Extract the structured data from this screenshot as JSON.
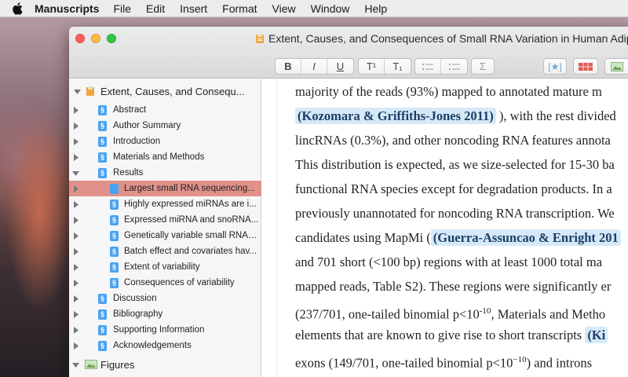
{
  "menubar": {
    "app_name": "Manuscripts",
    "items": [
      "File",
      "Edit",
      "Insert",
      "Format",
      "View",
      "Window",
      "Help"
    ]
  },
  "window": {
    "title": "Extent, Causes, and Consequences of Small RNA Variation in Human Adipos"
  },
  "toolbar": {
    "bold": "B",
    "italic": "I",
    "underline": "U",
    "superscript": "T¹",
    "subscript": "T₁",
    "equation": "Σ",
    "citation": "[★]"
  },
  "sidebar": {
    "root_label": "Extent, Causes, and Consequ...",
    "sections": [
      {
        "label": "Abstract"
      },
      {
        "label": "Author Summary"
      },
      {
        "label": "Introduction"
      },
      {
        "label": "Materials and Methods"
      },
      {
        "label": "Results"
      }
    ],
    "results_children": [
      {
        "label": "Largest small RNA sequencing..."
      },
      {
        "label": "Highly expressed miRNAs are i..."
      },
      {
        "label": "Expressed miRNA and snoRNA..."
      },
      {
        "label": "Genetically variable small RNAs..."
      },
      {
        "label": "Batch effect and covariates hav..."
      },
      {
        "label": "Extent of variability"
      },
      {
        "label": "Consequences of variability"
      }
    ],
    "more_sections": [
      {
        "label": "Discussion"
      },
      {
        "label": "Bibliography"
      },
      {
        "label": "Supporting Information"
      },
      {
        "label": "Acknowledgements"
      }
    ],
    "figures_label": "Figures"
  },
  "content": {
    "lines": [
      {
        "pre": "majority of the reads (93%) mapped to annotated mature m",
        "cite": "",
        "post": ""
      },
      {
        "pre": "",
        "cite": "(Kozomara & Griffiths-Jones 2011)",
        "post": " ), with the rest divided"
      },
      {
        "pre": "lincRNAs (0.3%), and other noncoding RNA features annota",
        "cite": "",
        "post": ""
      },
      {
        "pre": "This distribution is expected, as we size-selected for 15-30 ba",
        "cite": "",
        "post": ""
      },
      {
        "pre": "functional RNA species except for degradation products. In a",
        "cite": "",
        "post": ""
      },
      {
        "pre": "previously unannotated for noncoding RNA transcription. We",
        "cite": "",
        "post": ""
      },
      {
        "pre": "candidates using MapMi (",
        "cite": "(Guerra-Assuncao & Enright 201",
        "post": ""
      },
      {
        "pre": "and 701 short (<100 bp) regions with at least 1000 total ma",
        "cite": "",
        "post": ""
      },
      {
        "pre": "mapped reads, Table S2). These regions were significantly er",
        "cite": "",
        "post": ""
      },
      {
        "pre": "(237/701, one-tailed binomial p<10",
        "sup": "-10",
        "cite": "",
        "post": ", Materials and Metho"
      },
      {
        "pre": "elements that are known to give rise to short transcripts ",
        "cite": "(Ki",
        "post": ""
      },
      {
        "pre": "exons (149/701, one-tailed binomial p<10",
        "sup": "−10",
        "cite": "",
        "post": ") and introns"
      }
    ]
  }
}
